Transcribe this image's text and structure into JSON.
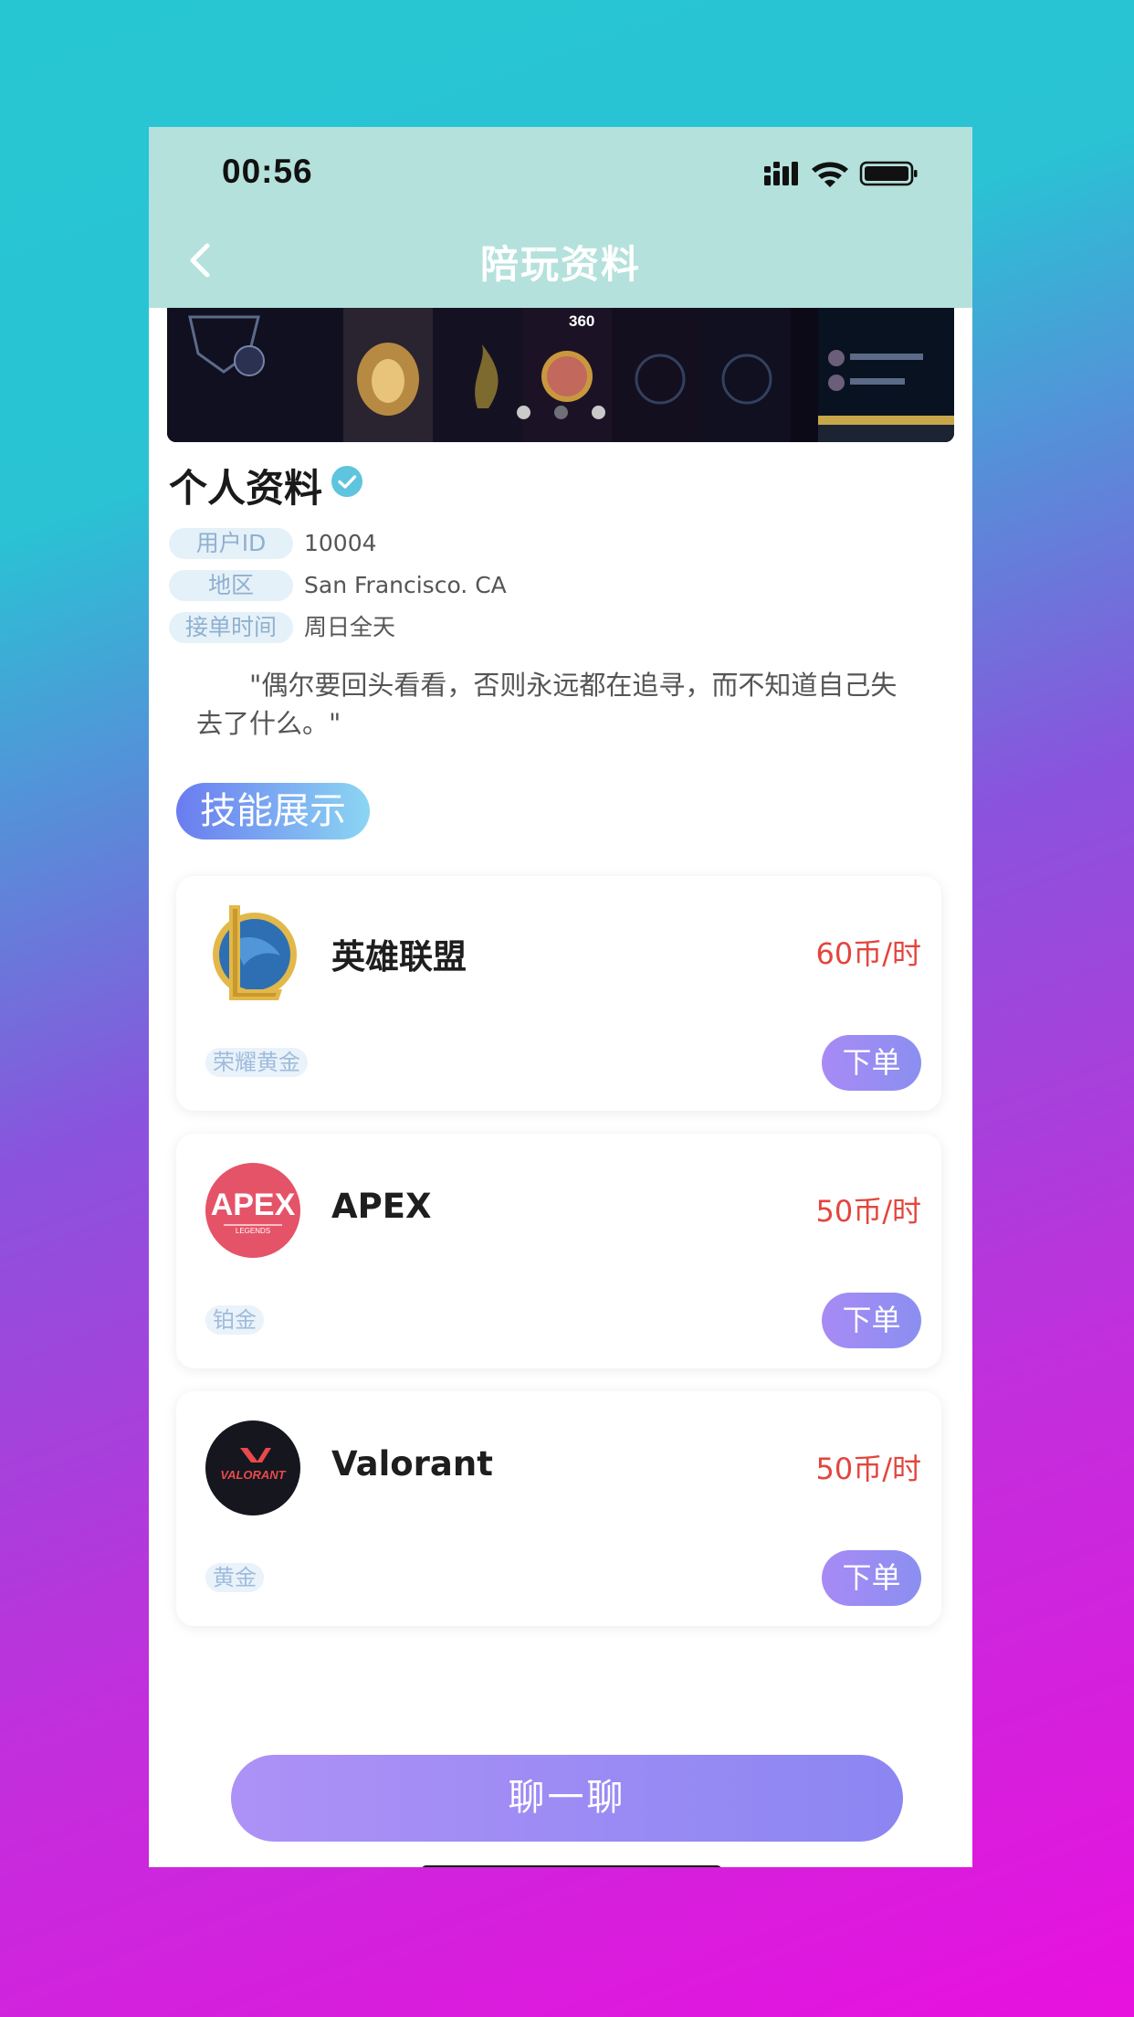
{
  "status_bar": {
    "time": "00:56"
  },
  "nav": {
    "title": "陪玩资料"
  },
  "banner": {
    "badge_value": "360",
    "slide_count": 3,
    "active_slide": 1
  },
  "profile": {
    "section_title": "个人资料",
    "rows": [
      {
        "label": "用户ID",
        "value": "10004"
      },
      {
        "label": "地区",
        "value": "San Francisco. CA"
      },
      {
        "label": "接单时间",
        "value": "周日全天"
      }
    ],
    "quote": "\"偶尔要回头看看，否则永远都在追寻，而不知道自己失去了什么。\""
  },
  "skills": {
    "section_title": "技能展示",
    "order_label": "下单",
    "items": [
      {
        "game": "英雄联盟",
        "price": "60币/时",
        "rank": "荣耀黄金",
        "icon": "league-of-legends-logo"
      },
      {
        "game": "APEX",
        "price": "50币/时",
        "rank": "铂金",
        "icon": "apex-legends-logo",
        "logo_text": "APEX",
        "logo_subtext": "LEGENDS"
      },
      {
        "game": "Valorant",
        "price": "50币/时",
        "rank": "黄金",
        "icon": "valorant-logo",
        "logo_text": "VALORANT"
      }
    ]
  },
  "chat_button": {
    "label": "聊一聊"
  },
  "colors": {
    "header_bg": "#b4e1dc",
    "price": "#e2463e",
    "button_purple": "#a08bf4",
    "tag_bg": "#e5f1f8"
  }
}
